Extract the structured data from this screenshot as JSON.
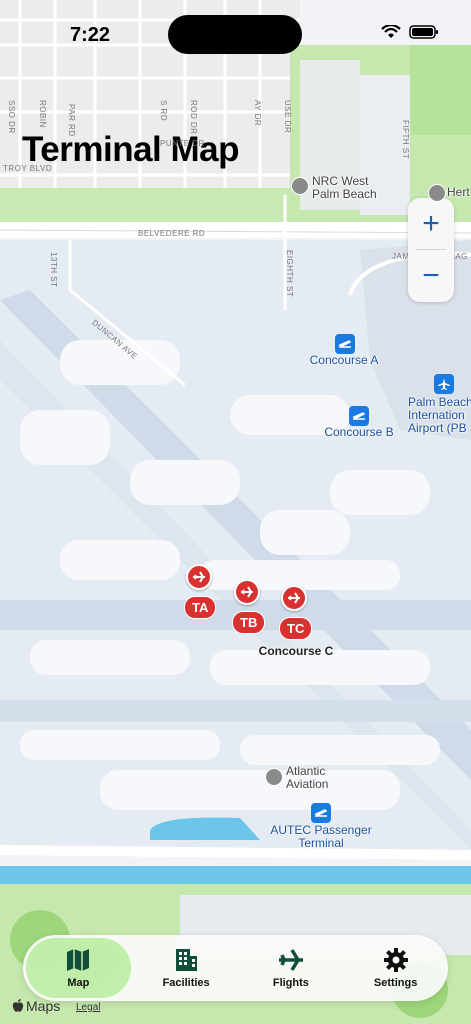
{
  "status": {
    "time": "7:22"
  },
  "header": {
    "title": "Terminal Map"
  },
  "zoom": {
    "in_label": "+",
    "out_label": "−"
  },
  "roads": {
    "belvedere": "BELVEDERE RD",
    "troy": "TROY BLVD",
    "thirteenth": "13TH ST",
    "duncan": "DUNCAN AVE",
    "eighth": "EIGHTH ST",
    "fifth": "FIFTH ST",
    "james": "JAMES L TURNAG",
    "osso": "SSO DR",
    "robin": "ROBIN",
    "parrd": "PAR RD",
    "srd": "S RD",
    "rodr": "ROD DR",
    "puntedr": "PUNTE DR",
    "aydr": "AY DR",
    "usedr": "USE DR"
  },
  "pois": {
    "nrc": "NRC West\nPalm Beach",
    "hertz": "Hert",
    "concourse_a": "Concourse A",
    "concourse_b": "Concourse B",
    "airport": "Palm Beach\nInternation\nAirport (PB",
    "concourse_c": "Concourse C",
    "atlantic": "Atlantic\nAviation",
    "autec": "AUTEC Passenger\nTerminal"
  },
  "gates": [
    {
      "id": "ta",
      "label": "TA"
    },
    {
      "id": "tb",
      "label": "TB"
    },
    {
      "id": "tc",
      "label": "TC"
    }
  ],
  "tabs": [
    {
      "label": "Map",
      "icon": "map-icon",
      "active": true
    },
    {
      "label": "Facilities",
      "icon": "building-icon",
      "active": false
    },
    {
      "label": "Flights",
      "icon": "airplane-icon",
      "active": false
    },
    {
      "label": "Settings",
      "icon": "gear-icon",
      "active": false
    }
  ],
  "footer": {
    "maps": "Maps",
    "legal": "Legal"
  },
  "colors": {
    "accent": "#1a5fb4",
    "gate": "#d9312f",
    "poi_blue": "#1a7ae0",
    "active_tab": "#96e66e"
  }
}
